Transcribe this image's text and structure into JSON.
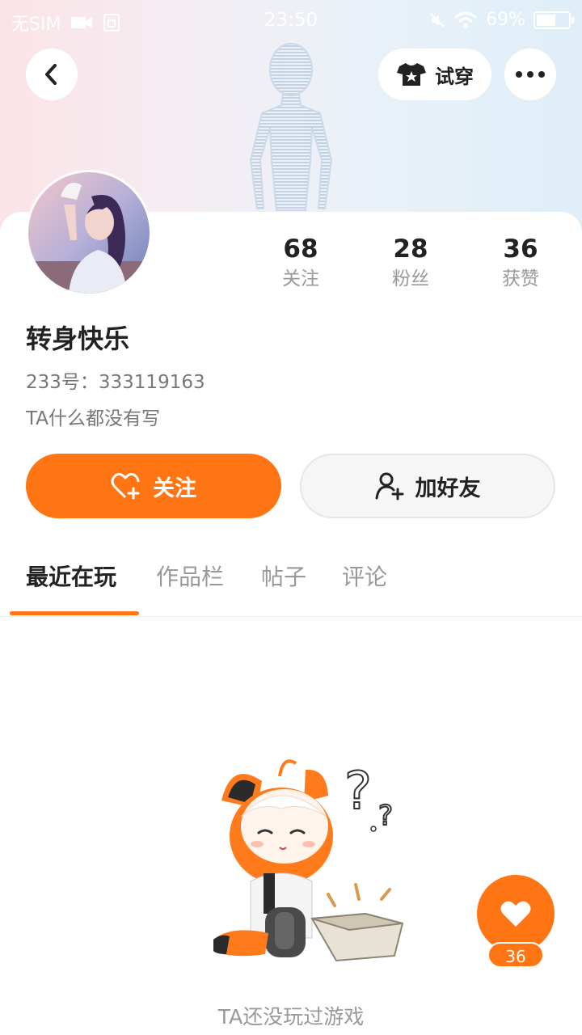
{
  "status_bar": {
    "carrier": "无SIM",
    "time": "23:50",
    "battery": "69%",
    "battery_level": 0.69
  },
  "header": {
    "tryon_label": "试穿"
  },
  "profile": {
    "nickname": "转身快乐",
    "uid": "233号：333119163",
    "bio": "TA什么都没有写"
  },
  "stats": [
    {
      "value": "68",
      "label": "关注"
    },
    {
      "value": "28",
      "label": "粉丝"
    },
    {
      "value": "36",
      "label": "获赞"
    }
  ],
  "actions": {
    "follow_label": "关注",
    "add_friend_label": "加好友"
  },
  "tabs": [
    {
      "label": "最近在玩",
      "active": true
    },
    {
      "label": "作品栏",
      "active": false
    },
    {
      "label": "帖子",
      "active": false
    },
    {
      "label": "评论",
      "active": false
    }
  ],
  "empty_state": {
    "text": "TA还没玩过游戏"
  },
  "like_fab": {
    "count": "36"
  },
  "colors": {
    "accent": "#ff7514",
    "muted_text": "#999999"
  }
}
